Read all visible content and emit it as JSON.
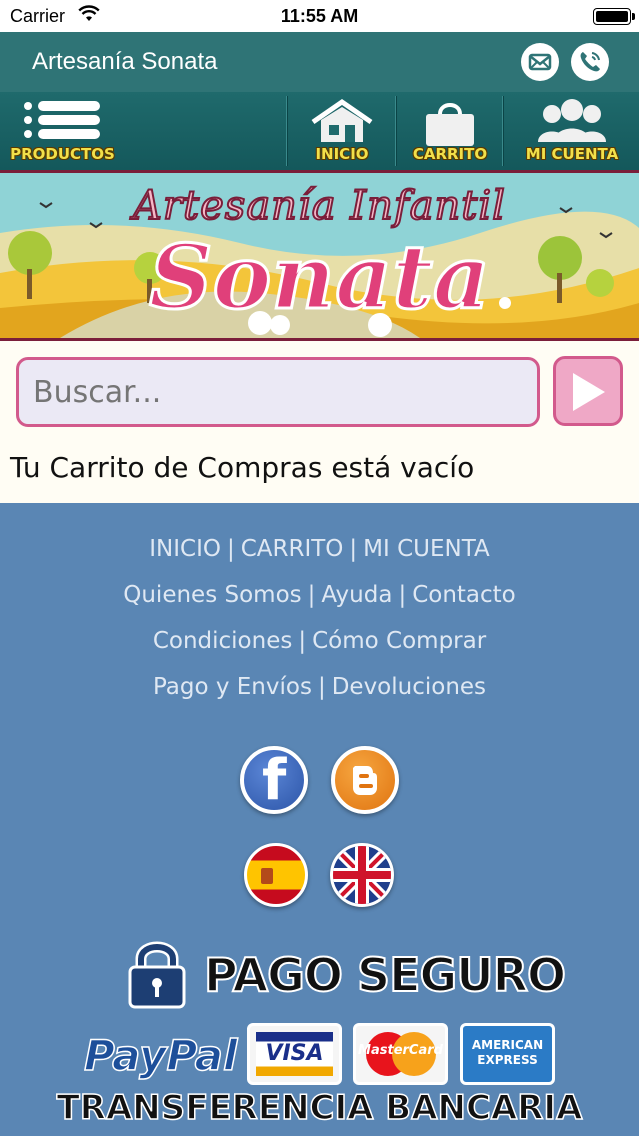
{
  "status_bar": {
    "carrier": "Carrier",
    "time": "11:55 AM"
  },
  "app": {
    "title": "Artesanía Sonata"
  },
  "header_icons": {
    "mail": "mail-icon",
    "phone": "phone-icon"
  },
  "nav": {
    "productos": "PRODUCTOS",
    "inicio": "INICIO",
    "carrito": "CARRITO",
    "mi_cuenta": "MI CUENTA"
  },
  "banner": {
    "line1": "Artesanía Infantil",
    "line2": "Sonata"
  },
  "search": {
    "placeholder": "Buscar..."
  },
  "cart": {
    "empty_message": "Tu Carrito de Compras está vacío"
  },
  "footer": {
    "links": [
      [
        "INICIO",
        "CARRITO",
        "MI CUENTA"
      ],
      [
        "Quienes Somos",
        "Ayuda",
        "Contacto"
      ],
      [
        "Condiciones",
        "Cómo Comprar"
      ],
      [
        "Pago y Envíos",
        "Devoluciones"
      ]
    ],
    "social": {
      "facebook": "f"
    },
    "secure_payment": "PAGO SEGURO",
    "paypal": "PayPal",
    "cards": {
      "visa": "VISA",
      "mastercard": "MasterCard",
      "amex_line1": "AMERICAN",
      "amex_line2": "EXPRESS"
    },
    "bank_transfer": "TRANSFERENCIA BANCARIA"
  },
  "colors": {
    "title_bar": "#2f7476",
    "nav_label": "#f2e04a",
    "accent_pink": "#d25a8c",
    "footer_bg": "#5a86b4"
  }
}
